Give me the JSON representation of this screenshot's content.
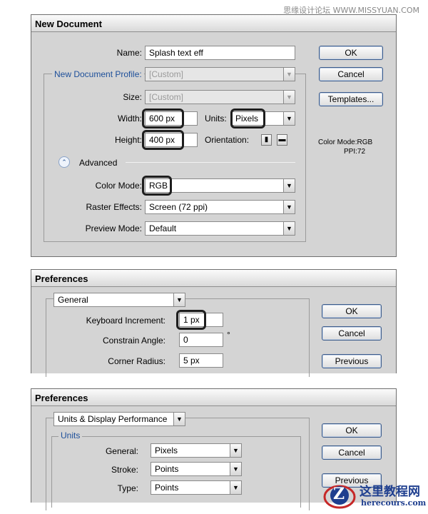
{
  "watermark": "思缘设计论坛 WWW.MISSYUAN.COM",
  "logo": {
    "letter": "Z",
    "cn": "这里教程网",
    "url": "herecours.com"
  },
  "dialog1": {
    "title": "New Document",
    "name_label": "Name:",
    "name_value": "Splash text eff",
    "profile_label": "New Document Profile:",
    "profile_value": "[Custom]",
    "size_label": "Size:",
    "size_value": "[Custom]",
    "width_label": "Width:",
    "width_value": "600 px",
    "units_label": "Units:",
    "units_value": "Pixels",
    "height_label": "Height:",
    "height_value": "400 px",
    "orientation_label": "Orientation:",
    "advanced_label": "Advanced",
    "color_mode_label": "Color Mode:",
    "color_mode_value": "RGB",
    "raster_label": "Raster Effects:",
    "raster_value": "Screen (72 ppi)",
    "preview_label": "Preview Mode:",
    "preview_value": "Default",
    "ok": "OK",
    "cancel": "Cancel",
    "templates": "Templates...",
    "info_color": "Color Mode:RGB",
    "info_ppi": "PPI:72"
  },
  "dialog2": {
    "title": "Preferences",
    "section": "General",
    "keyboard_label": "Keyboard Increment:",
    "keyboard_value": "1 px",
    "constrain_label": "Constrain Angle:",
    "constrain_value": "0",
    "degree": "°",
    "corner_label": "Corner Radius:",
    "corner_value": "5 px",
    "ok": "OK",
    "cancel": "Cancel",
    "previous": "Previous"
  },
  "dialog3": {
    "title": "Preferences",
    "section": "Units & Display Performance",
    "units_group": "Units",
    "general_label": "General:",
    "general_value": "Pixels",
    "stroke_label": "Stroke:",
    "stroke_value": "Points",
    "type_label": "Type:",
    "type_value": "Points",
    "ok": "OK",
    "cancel": "Cancel",
    "previous": "Previous"
  }
}
